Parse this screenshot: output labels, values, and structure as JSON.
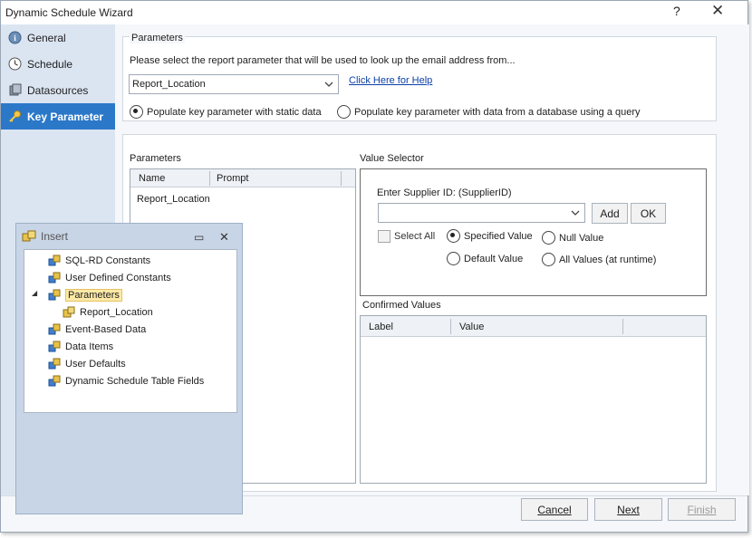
{
  "window": {
    "title": "Dynamic Schedule Wizard",
    "help_glyph": "?",
    "close_glyph": "✕"
  },
  "sidebar": {
    "items": [
      {
        "label": "General",
        "icon": "info-icon"
      },
      {
        "label": "Schedule",
        "icon": "clock-icon"
      },
      {
        "label": "Datasources",
        "icon": "database-icon"
      },
      {
        "label": "Key Parameter",
        "icon": "key-icon",
        "active": true
      }
    ]
  },
  "parameters_group": {
    "heading": "Parameters",
    "instruction": "Please select the report parameter that will be used to look up the email address from...",
    "selected_parameter": "Report_Location",
    "help_link": "Click Here for Help",
    "radio_static": "Populate key parameter with static data",
    "radio_query": "Populate key parameter with data from a database using a query"
  },
  "parameters_list": {
    "heading": "Parameters",
    "columns": [
      "Name",
      "Prompt"
    ],
    "rows": [
      {
        "name": "Report_Location",
        "prompt": ""
      }
    ]
  },
  "value_selector": {
    "heading": "Value Selector",
    "prompt": "Enter Supplier ID: (SupplierID)",
    "input_value": "",
    "add_label": "Add",
    "ok_label": "OK",
    "select_all": "Select All",
    "specified_value": "Specified Value",
    "null_value": "Null Value",
    "default_value": "Default Value",
    "all_values": "All Values (at runtime)"
  },
  "confirmed_values": {
    "heading": "Confirmed Values",
    "columns": [
      "Label",
      "Value"
    ]
  },
  "insert_panel": {
    "title": "Insert",
    "minimize_glyph": "▭",
    "close_glyph": "✕",
    "items": [
      {
        "label": "SQL-RD Constants",
        "level": 1
      },
      {
        "label": "User Defined Constants",
        "level": 1
      },
      {
        "label": "Parameters",
        "level": 1,
        "expanded": true,
        "selected": true
      },
      {
        "label": "Report_Location",
        "level": 2
      },
      {
        "label": "Event-Based Data",
        "level": 1
      },
      {
        "label": "Data Items",
        "level": 1
      },
      {
        "label": "User Defaults",
        "level": 1
      },
      {
        "label": "Dynamic Schedule Table Fields",
        "level": 1
      }
    ]
  },
  "footer": {
    "cancel_label": "Cancel",
    "next_label": "Next",
    "finish_label": "Finish"
  },
  "colors": {
    "sidebar_bg": "#dbe5f1",
    "active_nav": "#2b78c9",
    "link": "#0b3fa8",
    "insert_bg": "#c8d5e6"
  }
}
